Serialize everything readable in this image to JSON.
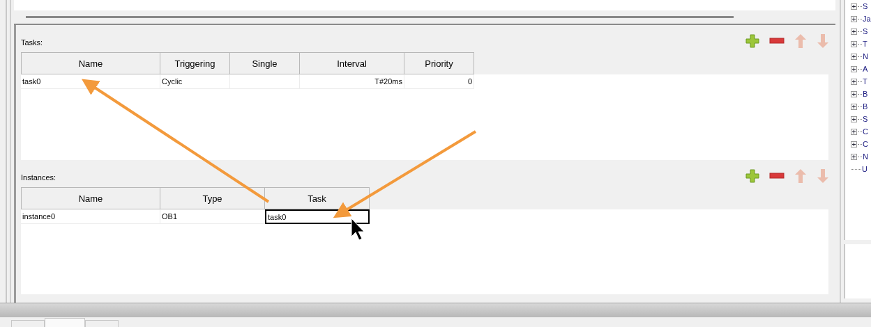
{
  "tasks": {
    "label": "Tasks:",
    "toolbar": [
      {
        "kind": "add",
        "disabled": false
      },
      {
        "kind": "remove",
        "disabled": false
      },
      {
        "kind": "up",
        "disabled": true
      },
      {
        "kind": "down",
        "disabled": true
      }
    ],
    "columns": [
      {
        "label": "Name",
        "kind": "text"
      },
      {
        "label": "Triggering",
        "kind": "text"
      },
      {
        "label": "Single",
        "kind": "text"
      },
      {
        "label": "Interval",
        "kind": "number"
      },
      {
        "label": "Priority",
        "kind": "number"
      }
    ],
    "rows": [
      {
        "cells": [
          {
            "text": "task0"
          },
          {
            "text": "Cyclic"
          },
          {},
          {
            "text": "T#20ms"
          },
          {
            "text": "0"
          }
        ]
      }
    ]
  },
  "instances": {
    "label": "Instances:",
    "toolbar": [
      {
        "kind": "add",
        "disabled": false
      },
      {
        "kind": "remove",
        "disabled": false
      },
      {
        "kind": "up",
        "disabled": true
      },
      {
        "kind": "down",
        "disabled": true
      }
    ],
    "columns": [
      {
        "label": "Name"
      },
      {
        "label": "Type"
      },
      {
        "label": "Task"
      }
    ],
    "rows": [
      {
        "cells": [
          {
            "text": "instance0",
            "editing": false
          },
          {
            "text": "OB1",
            "editing": false
          },
          {
            "text": "task0",
            "editing": true
          }
        ]
      }
    ]
  },
  "tree": [
    {
      "label": "S",
      "expandable": true
    },
    {
      "label": "Ja",
      "expandable": true
    },
    {
      "label": "S",
      "expandable": true
    },
    {
      "label": "T",
      "expandable": true
    },
    {
      "label": "N",
      "expandable": true
    },
    {
      "label": "A",
      "expandable": true
    },
    {
      "label": "T",
      "expandable": true
    },
    {
      "label": "B",
      "expandable": true
    },
    {
      "label": "B",
      "expandable": true
    },
    {
      "label": "S",
      "expandable": true
    },
    {
      "label": "C",
      "expandable": true
    },
    {
      "label": "C",
      "expandable": true
    },
    {
      "label": "N",
      "expandable": true
    },
    {
      "label": "U",
      "expandable": false
    }
  ],
  "bottom_tabs": [
    {
      "selected": false
    },
    {
      "selected": true
    },
    {
      "selected": false
    }
  ]
}
